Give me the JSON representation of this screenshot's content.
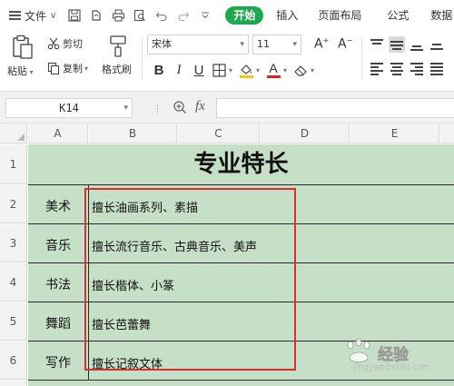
{
  "menubar": {
    "file_label": "文件",
    "tabs": [
      "开始",
      "插入",
      "页面布局",
      "公式",
      "数据"
    ],
    "active_tab_color": "#1ea94f"
  },
  "toolbar": {
    "paste_label": "粘贴",
    "cut_label": "剪切",
    "copy_label": "复制",
    "format_painter_label": "格式刷",
    "font_name": "宋体",
    "font_size": "11",
    "bold": "B",
    "italic": "I",
    "underline": "U",
    "font_color_glyph": "A",
    "font_color": "#e02020",
    "highlight_color": "#f5c518",
    "icons": [
      "paste-icon",
      "cut-icon",
      "copy-icon",
      "format-painter-icon",
      "border-icon",
      "fill-color-icon",
      "font-color-icon",
      "eraser-icon"
    ]
  },
  "formula_bar": {
    "cell_ref": "K14",
    "fx_label": "fx",
    "formula": ""
  },
  "sheet": {
    "columns": [
      "A",
      "B",
      "C",
      "D",
      "E"
    ],
    "rows": [
      "1",
      "2",
      "3",
      "4",
      "5",
      "6"
    ],
    "fill_color": "#c6e0c7",
    "title": "专业特长",
    "records": [
      {
        "subject": "美术",
        "detail": "擅长油画系列、素描"
      },
      {
        "subject": "音乐",
        "detail": "擅长流行音乐、古典音乐、美声"
      },
      {
        "subject": "书法",
        "detail": "擅长楷体、小篆"
      },
      {
        "subject": "舞蹈",
        "detail": "擅长芭蕾舞"
      },
      {
        "subject": "写作",
        "detail": "擅长记叙文体"
      }
    ],
    "highlight_border_color": "#d92f2f"
  },
  "watermark": {
    "text": "经验",
    "url": "jingyan.baidu.com"
  }
}
